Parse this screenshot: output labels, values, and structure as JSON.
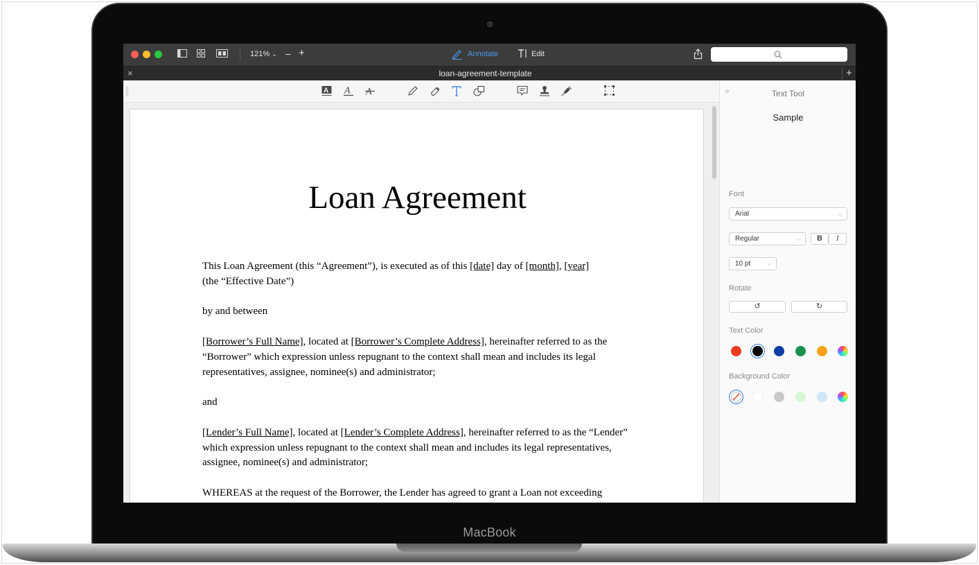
{
  "device": {
    "brand": "MacBook"
  },
  "titlebar": {
    "zoom": "121%",
    "zoom_out": "–",
    "zoom_in": "+",
    "mode_annotate": "Annotate",
    "mode_edit": "Edit",
    "search_placeholder": ""
  },
  "tab": {
    "title": "loan-agreement-template",
    "close": "×",
    "new_tab": "+"
  },
  "document": {
    "title": "Loan Agreement",
    "p1a": "This Loan Agreement (this “Agreement”), is executed as of this ",
    "date": "[date]",
    "p1b": " day of ",
    "month": "[month]",
    "p1c": ", ",
    "year": "[year]",
    "p1d": " (the “Effective Date”)",
    "p2": "by and between",
    "borrower_name": "[Borrower’s Full Name]",
    "p3a": ", located at ",
    "borrower_address": "[Borrower’s Complete Address]",
    "p3b": ", hereinafter referred to as the “Borrower” which expression unless repugnant to the context shall mean and includes its legal representatives, assignee, nominee(s) and administrator;",
    "p4": "and",
    "lender_name": "[Lender’s Full Name]",
    "p5a": ", located at ",
    "lender_address": "[Lender’s Complete Address]",
    "p5b": ", hereinafter referred to as the “Lender” which expression unless repugnant to the context shall mean and includes its legal representatives, assignee, nominee(s) and administrator;",
    "p6": "WHEREAS at the request of the Borrower, the Lender has agreed to grant a Loan not exceeding"
  },
  "panel": {
    "title": "Text Tool",
    "sample": "Sample",
    "font_label": "Font",
    "font_value": "Arial",
    "style_value": "Regular",
    "bold": "B",
    "italic": "I",
    "size_value": "10 pt",
    "rotate_label": "Rotate",
    "rotate_left": "↺",
    "rotate_right": "↻",
    "text_color_label": "Text Color",
    "text_colors": [
      "#ea3a1b",
      "#000000",
      "#0d3ea8",
      "#17904b",
      "#f6a21b",
      "conic"
    ],
    "background_color_label": "Background Color",
    "background_colors": [
      "none",
      "#ffffff",
      "#c8c8c8",
      "#d6f7d4",
      "#cfe6fb",
      "conic"
    ]
  }
}
